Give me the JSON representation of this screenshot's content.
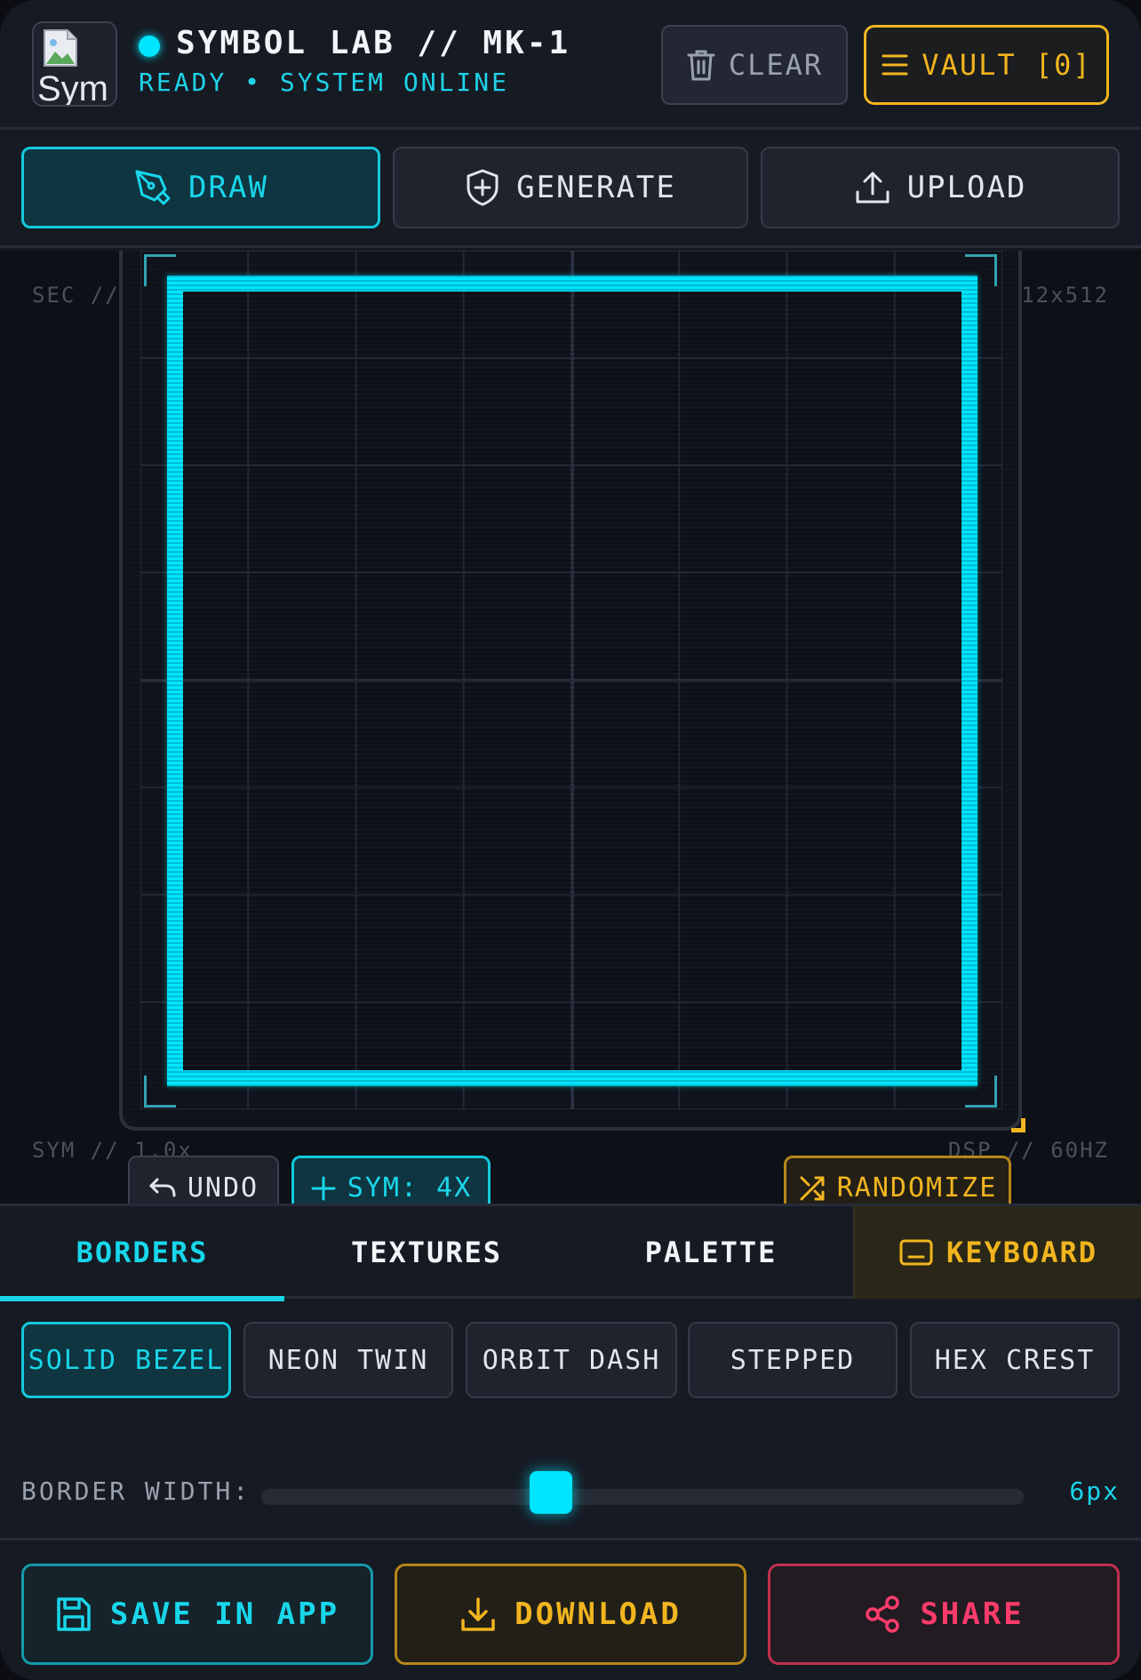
{
  "header": {
    "logo_text": "Sym",
    "title": "SYMBOL LAB // MK-1",
    "status": "READY • SYSTEM ONLINE",
    "clear_label": "CLEAR",
    "vault_label": "VAULT [0]"
  },
  "modes": [
    {
      "label": "DRAW",
      "icon": "pen-icon",
      "active": true
    },
    {
      "label": "GENERATE",
      "icon": "shield-plus-icon",
      "active": false
    },
    {
      "label": "UPLOAD",
      "icon": "upload-icon",
      "active": false
    }
  ],
  "workspace": {
    "label_top_left": "SEC //",
    "label_top_right": "12x512",
    "label_bottom_left": "SYM // 1.0x",
    "label_bottom_right": "DSP // 60HZ",
    "undo_label": "UNDO",
    "sym_label": "SYM: 4X",
    "randomize_label": "RANDOMIZE"
  },
  "tabs": [
    {
      "label": "BORDERS",
      "active": true
    },
    {
      "label": "TEXTURES",
      "active": false
    },
    {
      "label": "PALETTE",
      "active": false
    },
    {
      "label": "KEYBOARD",
      "icon": "keyboard-icon",
      "active": false
    }
  ],
  "border_styles": [
    {
      "label": "SOLID BEZEL",
      "active": true
    },
    {
      "label": "NEON TWIN",
      "active": false
    },
    {
      "label": "ORBIT DASH",
      "active": false
    },
    {
      "label": "STEPPED",
      "active": false
    },
    {
      "label": "HEX CREST",
      "active": false
    }
  ],
  "border_width": {
    "label": "BORDER WIDTH:",
    "value_text": "6px",
    "level": 0.38
  },
  "actions": {
    "save_label": "SAVE IN APP",
    "download_label": "DOWNLOAD",
    "share_label": "SHARE"
  },
  "colors": {
    "accent_cyan": "#00e5ff",
    "accent_amber": "#f1b51f",
    "accent_pink": "#ff3b6b",
    "background": "#141821"
  }
}
